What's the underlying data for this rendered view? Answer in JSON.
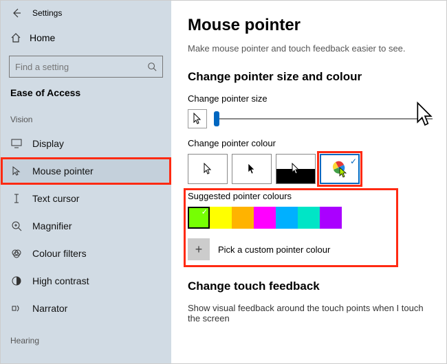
{
  "app": {
    "title": "Settings"
  },
  "sidebar": {
    "home": "Home",
    "search_placeholder": "Find a setting",
    "category": "Ease of Access",
    "group1": "Vision",
    "group2": "Hearing",
    "items": [
      {
        "label": "Display"
      },
      {
        "label": "Mouse pointer"
      },
      {
        "label": "Text cursor"
      },
      {
        "label": "Magnifier"
      },
      {
        "label": "Colour filters"
      },
      {
        "label": "High contrast"
      },
      {
        "label": "Narrator"
      }
    ]
  },
  "main": {
    "title": "Mouse pointer",
    "subtitle": "Make mouse pointer and touch feedback easier to see.",
    "section1": "Change pointer size and colour",
    "size_label": "Change pointer size",
    "colour_label": "Change pointer colour",
    "suggested_label": "Suggested pointer colours",
    "custom_label": "Pick a custom pointer colour",
    "swatches": [
      "#76ff03",
      "#ffff00",
      "#ffb300",
      "#ff00ff",
      "#00b0ff",
      "#00e5c6",
      "#aa00ff"
    ],
    "touch_title": "Change touch feedback",
    "touch_desc": "Show visual feedback around the touch points when I touch the screen"
  }
}
